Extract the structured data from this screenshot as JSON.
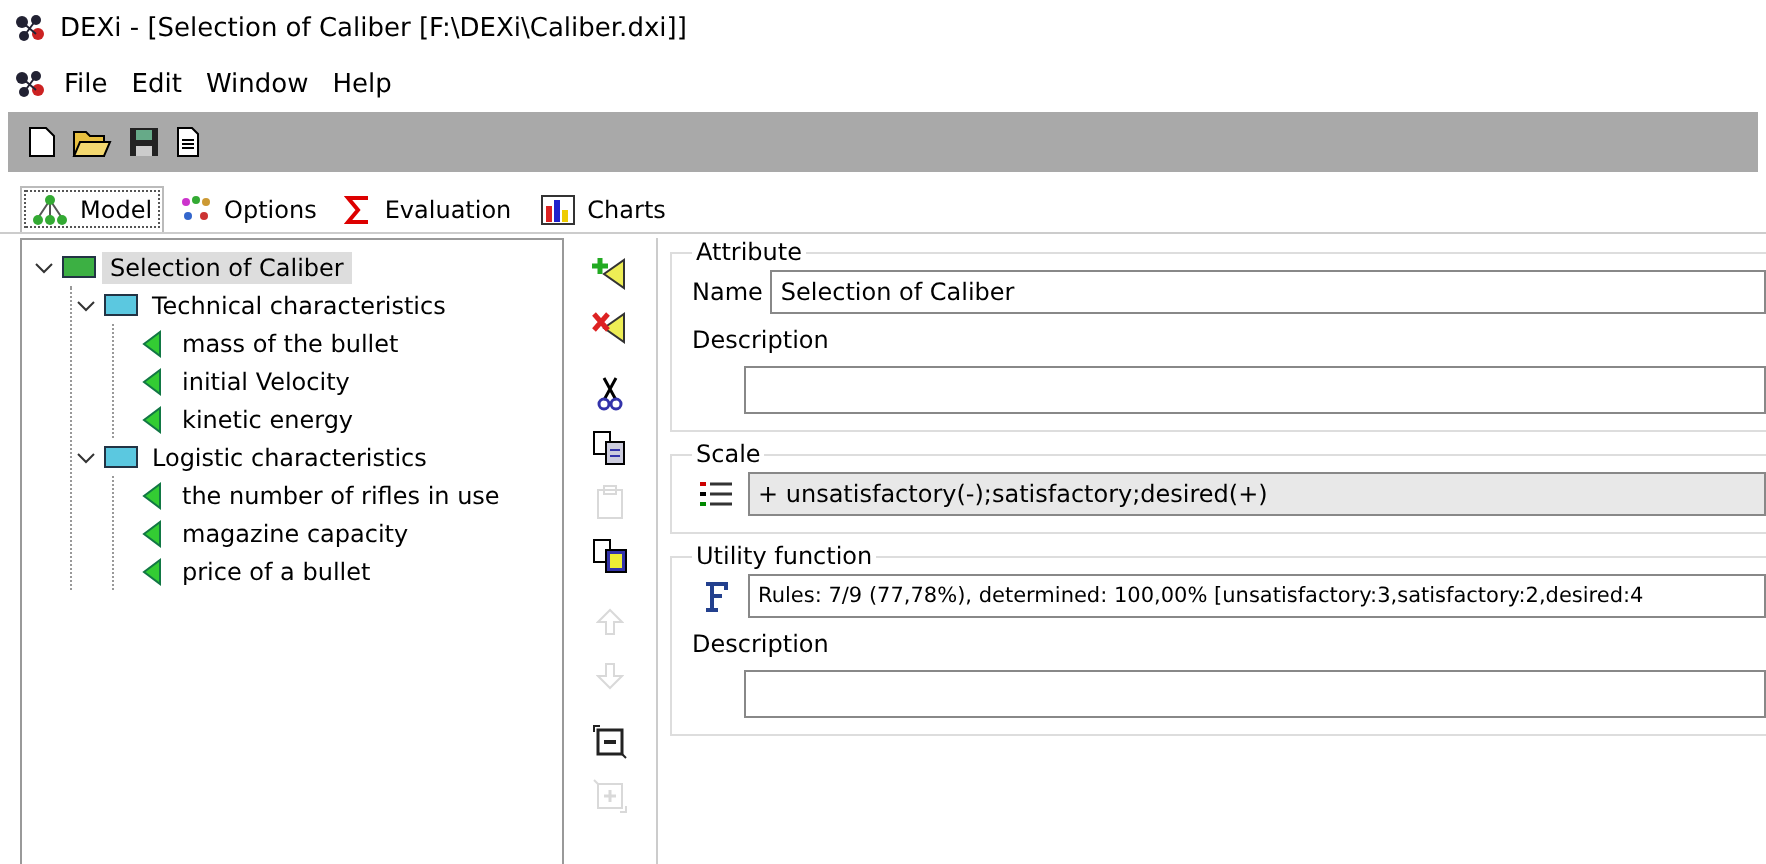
{
  "window": {
    "title": "DEXi - [Selection of Caliber [F:\\DEXi\\Caliber.dxi]]"
  },
  "menu": [
    "File",
    "Edit",
    "Window",
    "Help"
  ],
  "toolbar": [
    {
      "kind": "new"
    },
    {
      "kind": "open"
    },
    {
      "kind": "save"
    },
    {
      "kind": "report"
    }
  ],
  "tabs": [
    {
      "label": "Model",
      "kind": "model",
      "selected": true
    },
    {
      "label": "Options",
      "kind": "options",
      "selected": false
    },
    {
      "label": "Evaluation",
      "kind": "evaluation",
      "selected": false
    },
    {
      "label": "Charts",
      "kind": "charts",
      "selected": false
    }
  ],
  "tree": [
    {
      "label": "Selection of Caliber",
      "kind": "aggregate",
      "color": "#3cb043",
      "selected": true,
      "expanded": true,
      "children": [
        {
          "label": "Technical characteristics",
          "kind": "aggregate",
          "color": "#5bc8e0",
          "selected": false,
          "expanded": true,
          "children": [
            {
              "label": "mass of the bullet",
              "kind": "basic",
              "selected": false
            },
            {
              "label": "initial Velocity",
              "kind": "basic",
              "selected": false
            },
            {
              "label": "kinetic energy",
              "kind": "basic",
              "selected": false
            }
          ]
        },
        {
          "label": "Logistic characteristics",
          "kind": "aggregate",
          "color": "#5bc8e0",
          "selected": false,
          "expanded": true,
          "children": [
            {
              "label": "the number of rifles in use",
              "kind": "basic",
              "selected": false
            },
            {
              "label": "magazine capacity",
              "kind": "basic",
              "selected": false
            },
            {
              "label": "price of a bullet",
              "kind": "basic",
              "selected": false
            }
          ]
        }
      ]
    }
  ],
  "side_tools": [
    {
      "kind": "add",
      "disabled": false
    },
    {
      "kind": "delete",
      "disabled": false
    },
    {
      "kind": "cut",
      "disabled": false
    },
    {
      "kind": "copy",
      "disabled": false
    },
    {
      "kind": "paste",
      "disabled": true
    },
    {
      "kind": "duplicate",
      "disabled": false
    },
    {
      "kind": "up",
      "disabled": true
    },
    {
      "kind": "down",
      "disabled": true
    },
    {
      "kind": "collapse",
      "disabled": false
    },
    {
      "kind": "expand",
      "disabled": true
    }
  ],
  "attribute": {
    "title": "Attribute",
    "name_label": "Name",
    "name_value": "Selection of Caliber",
    "description_label": "Description"
  },
  "scale": {
    "title": "Scale",
    "value": "+ unsatisfactory(-);satisfactory;desired(+)"
  },
  "utility_function": {
    "title": "Utility function",
    "value": "Rules: 7/9 (77,78%), determined: 100,00% [unsatisfactory:3,satisfactory:2,desired:4",
    "description_label": "Description"
  }
}
